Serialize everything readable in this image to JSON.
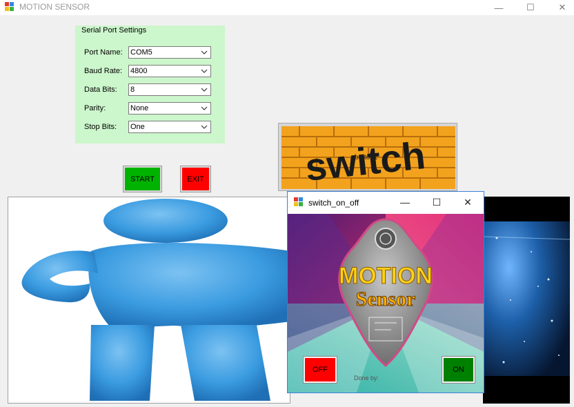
{
  "window": {
    "title": "MOTION SENSOR",
    "controls": {
      "minimize": "—",
      "maximize": "☐",
      "close": "✕"
    }
  },
  "serial_settings": {
    "group_title": "Serial Port Settings",
    "rows": [
      {
        "label": "Port Name:",
        "value": "COM5"
      },
      {
        "label": "Baud Rate:",
        "value": "4800"
      },
      {
        "label": "Data Bits:",
        "value": "8"
      },
      {
        "label": "Parity:",
        "value": "None"
      },
      {
        "label": "Stop Bits:",
        "value": "One"
      }
    ]
  },
  "buttons": {
    "start": "START",
    "exit": "EXIT",
    "switch_image_button": "button1"
  },
  "switch_image": {
    "text": "switch"
  },
  "dialog": {
    "title": "switch_on_off",
    "controls": {
      "minimize": "—",
      "maximize": "☐",
      "close": "✕"
    },
    "splash_line1": "MOTION",
    "splash_line2": "Sensor",
    "done_by": "Done by:",
    "off_label": "OFF",
    "on_label": "ON"
  },
  "colors": {
    "group_bg": "#ccf6cc",
    "start_bg": "#00b300",
    "exit_bg": "#ff0000",
    "off_bg": "#ff0000",
    "on_bg": "#008000",
    "figure_blue": "#3a9be0",
    "accent_border": "#3b7fd6"
  }
}
